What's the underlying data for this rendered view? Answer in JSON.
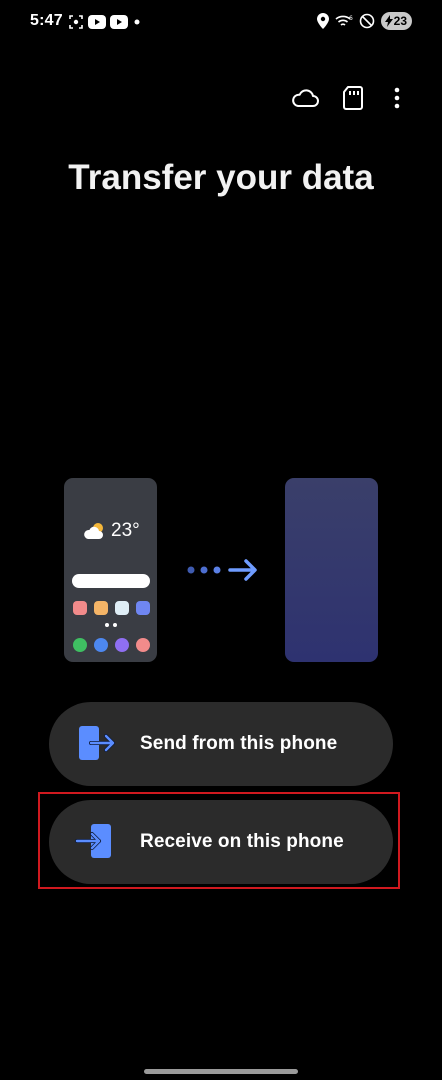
{
  "status_bar": {
    "time": "5:47",
    "battery_level": "23",
    "left_icons": [
      "screenshot-icon",
      "youtube-icon",
      "youtube-icon",
      "dot-icon"
    ],
    "right_icons": [
      "location-icon",
      "wifi-icon",
      "do-not-disturb-icon",
      "battery-charging-icon"
    ]
  },
  "toolbar": {
    "icons": [
      "cloud-icon",
      "sd-card-icon",
      "more-options-icon"
    ]
  },
  "page": {
    "title": "Transfer your data"
  },
  "illustration": {
    "weather_temp": "23°",
    "colors": {
      "source_phone": "#3a3d44",
      "target_phone": "#2e3270",
      "arrow": "#6f9cff"
    }
  },
  "options": {
    "send_label": "Send from this phone",
    "receive_label": "Receive on this phone"
  },
  "colors": {
    "accent": "#5b8dff",
    "button_bg": "#2b2b2b",
    "highlight": "#d0191f"
  }
}
